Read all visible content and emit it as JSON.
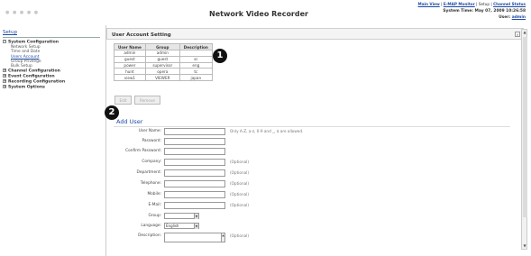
{
  "header": {
    "logo_dots": "● ● ● ● ●",
    "title": "Network Video Recorder",
    "links": {
      "main_view": "Main View",
      "sep1": " | ",
      "e_map": "E-MAP Monitor",
      "sep2": " | Setup | ",
      "channel_status": "Channel Status"
    },
    "system_time": "System Time: May 07, 2009 10:26:58",
    "user_prefix": "User: ",
    "user_name": "admin"
  },
  "sidebar": {
    "setup_label": "Setup",
    "sections": [
      {
        "label": "System Configuration",
        "expanded": true,
        "items": [
          "Network Setup",
          "Time and Date",
          "Users Account",
          "Group Privilege",
          "Bulk Setup"
        ]
      },
      {
        "label": "Channel Configuration"
      },
      {
        "label": "Event Configuration"
      },
      {
        "label": "Recording Configuration"
      },
      {
        "label": "System Options"
      }
    ]
  },
  "main": {
    "panel_title": "User Account Setting",
    "table": {
      "headers": [
        "User Name",
        "Group",
        "Description"
      ],
      "rows": [
        [
          "admin",
          "admin",
          ""
        ],
        [
          "guest",
          "guest",
          "sc"
        ],
        [
          "power",
          "supervisor",
          "eng"
        ],
        [
          "hunt",
          "opera",
          "tc"
        ],
        [
          "view1",
          "VIEWER",
          "japan"
        ]
      ]
    },
    "callouts": [
      "1",
      "2"
    ],
    "buttons": {
      "edit": "Edit",
      "remove": "Remove"
    },
    "add_user": {
      "title": "Add User",
      "fields": [
        {
          "label": "User Name:",
          "note": "Only A-Z, a-z, 0-9 and _, $ are allowed."
        },
        {
          "label": "Password:",
          "note": ""
        },
        {
          "label": "Confirm Password:",
          "note": ""
        },
        {
          "label": "Company:",
          "note": "(Optional)"
        },
        {
          "label": "Department:",
          "note": "(Optional)"
        },
        {
          "label": "Telephone:",
          "note": "(Optional)"
        },
        {
          "label": "Mobile:",
          "note": "(Optional)"
        },
        {
          "label": "E-Mail:",
          "note": "(Optional)"
        },
        {
          "label": "Group:",
          "note": "",
          "select": ""
        },
        {
          "label": "Language:",
          "note": "",
          "select": "English"
        },
        {
          "label": "Description:",
          "note": "(Optional)"
        }
      ]
    }
  }
}
